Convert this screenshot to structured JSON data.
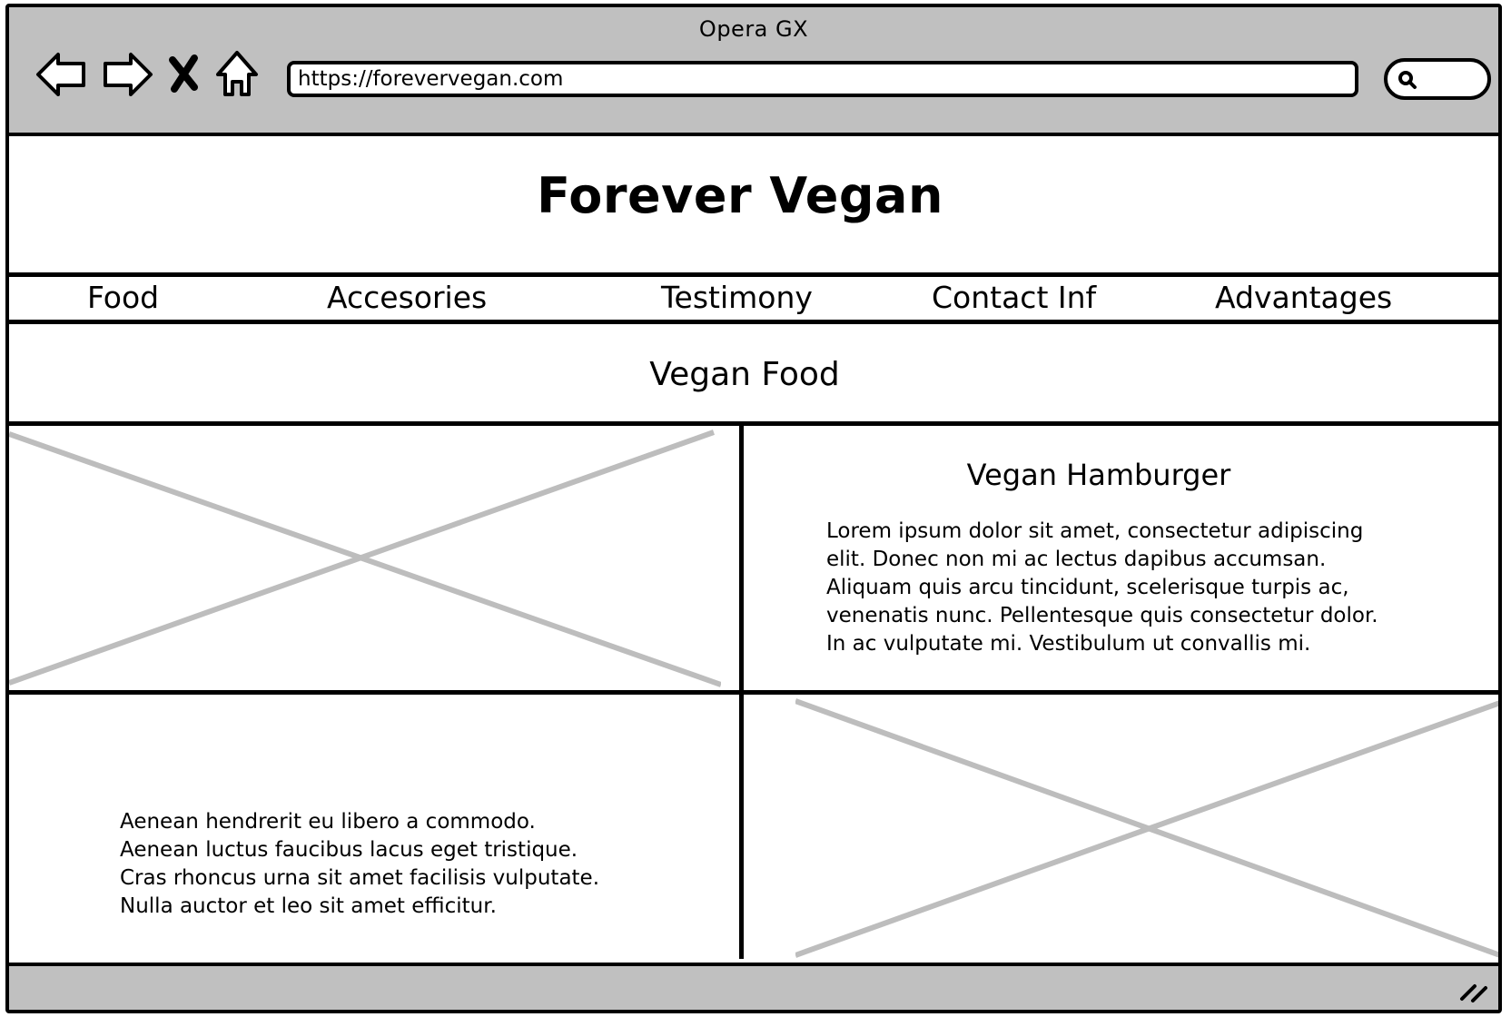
{
  "window": {
    "title": "Opera GX"
  },
  "toolbar": {
    "url": "https://forevervegan.com",
    "icons": [
      "back-arrow-icon",
      "forward-arrow-icon",
      "close-icon",
      "home-icon",
      "search-icon"
    ]
  },
  "site": {
    "title": "Forever Vegan"
  },
  "menu": {
    "items": [
      {
        "label": "Food"
      },
      {
        "label": "Accesories"
      },
      {
        "label": "Testimony"
      },
      {
        "label": "Contact Inf"
      },
      {
        "label": "Advantages"
      }
    ]
  },
  "section": {
    "title": "Vegan Food"
  },
  "card": {
    "title": "Vegan Hamburger",
    "lines": [
      "Lorem ipsum dolor sit amet, consectetur adipiscing",
      "elit. Donec non mi ac lectus dapibus accumsan.",
      "Aliquam quis arcu tincidunt, scelerisque turpis ac,",
      "venenatis nunc. Pellentesque quis consectetur dolor.",
      "In ac vulputate mi. Vestibulum ut convallis mi."
    ]
  },
  "side_text": {
    "lines": [
      "Aenean hendrerit eu libero a commodo.",
      "Aenean luctus faucibus lacus eget tristique.",
      "Cras rhoncus urna sit amet facilisis vulputate.",
      "Nulla auctor et leo sit amet efficitur."
    ]
  },
  "colors": {
    "chrome": "#c0c0c0",
    "border": "#000000",
    "placeholder_x": "#bdbdbd"
  }
}
